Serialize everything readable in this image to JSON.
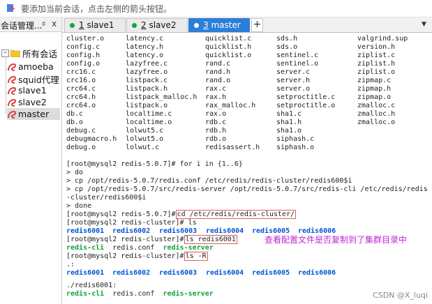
{
  "hint": {
    "icon": "arrow-hint-icon",
    "text": "要添加当前会话，点击左侧的箭头按钮。"
  },
  "left_panel": {
    "title": "会话管理...",
    "pin": "♯",
    "close": "x",
    "root": "所有会话",
    "sessions": [
      "amoeba",
      "squid代理",
      "slave1",
      "slave2",
      "master"
    ]
  },
  "tabs": [
    {
      "num": "1",
      "name": " slave1"
    },
    {
      "num": "2",
      "name": " slave2"
    },
    {
      "num": "3",
      "name": " master"
    }
  ],
  "tab_add": "+",
  "tab_menu": "▼",
  "colors": {
    "accent": "#2b7fd8",
    "status_green": "#16a34a",
    "dir_blue": "#0055d4",
    "exec_green": "#10a33a",
    "annotation": "#c026d3",
    "highlight_box": "#e25b5b"
  },
  "terminal": {
    "ls_grid": [
      [
        "cluster.o",
        "latency.c",
        "quicklist.c",
        "sds.h",
        "valgrind.sup"
      ],
      [
        "config.c",
        "latency.h",
        "quicklist.h",
        "sds.o",
        "version.h"
      ],
      [
        "config.h",
        "latency.o",
        "quicklist.o",
        "sentinel.c",
        "ziplist.c"
      ],
      [
        "config.o",
        "lazyfree.c",
        "rand.c",
        "sentinel.o",
        "ziplist.h"
      ],
      [
        "crc16.c",
        "lazyfree.o",
        "rand.h",
        "server.c",
        "ziplist.o"
      ],
      [
        "crc16.o",
        "listpack.c",
        "rand.o",
        "server.h",
        "zipmap.c"
      ],
      [
        "crc64.c",
        "listpack.h",
        "rax.c",
        "server.o",
        "zipmap.h"
      ],
      [
        "crc64.h",
        "listpack_malloc.h",
        "rax.h",
        "setproctitle.c",
        "zipmap.o"
      ],
      [
        "crc64.o",
        "listpack.o",
        "rax_malloc.h",
        "setproctitle.o",
        "zmalloc.c"
      ],
      [
        "db.c",
        "localtime.c",
        "rax.o",
        "sha1.c",
        "zmalloc.h"
      ],
      [
        "db.o",
        "localtime.o",
        "rdb.c",
        "sha1.h",
        "zmalloc.o"
      ],
      [
        "debug.c",
        "lolwut5.c",
        "rdb.h",
        "sha1.o",
        ""
      ],
      [
        "debugmacro.h",
        "lolwut5.o",
        "rdb.o",
        "siphash.c",
        ""
      ],
      [
        "debug.o",
        "lolwut.c",
        "redisassert.h",
        "siphash.o",
        ""
      ]
    ],
    "for_line": "[root@mysql2 redis-5.0.7]# for i in {1..6}",
    "do_line": "> do",
    "cp1": "> cp /opt/redis-5.0.7/redis.conf /etc/redis/redis-cluster/redis600$i",
    "cp2a": "> cp /opt/redis-5.0.7/src/redis-server /opt/redis-5.0.7/src/redis-cli /etc/redis/redis",
    "cp2b": "-cluster/redis600$i",
    "done_line": "> done",
    "cd_prompt": "[root@mysql2 redis-5.0.7]#",
    "cd_cmd": "cd /etc/redis/redis-cluster/",
    "ls_prompt": "[root@mysql2 redis-cluster]# ls",
    "dirs": [
      "redis6001",
      "redis6002",
      "redis6003",
      "redis6004",
      "redis6005",
      "redis6006"
    ],
    "ls1_prompt": "[root@mysql2 redis-cluster]#",
    "ls1_cmd": "ls redis6001",
    "ls1_cli": "redis-cli",
    "ls1_conf": "redis.conf",
    "ls1_server": "redis-server",
    "lsr_prompt": "[root@mysql2 redis-cluster]#",
    "lsr_cmd": "ls -R",
    "dot_line": ".:",
    "sub_dir": "./redis6001:",
    "sub_cli": "redis-cli",
    "sub_conf": "redis.conf",
    "sub_server": "redis-server"
  },
  "annotation": "查看配置文件是否复制到了集群目录中",
  "watermark": "CSDN @X_luqi"
}
